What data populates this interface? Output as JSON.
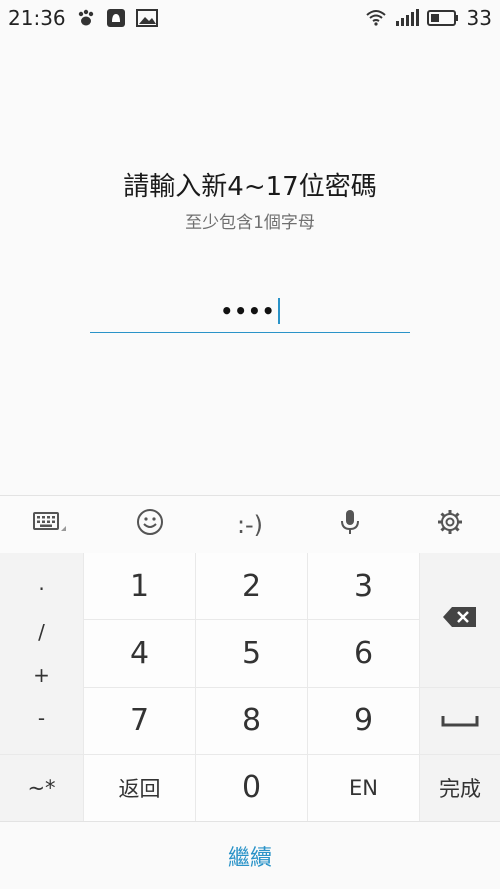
{
  "status_bar": {
    "time": "21:36",
    "battery": "33",
    "icons": [
      "paw-icon",
      "notification-icon",
      "image-icon",
      "wifi-icon",
      "signal-icon",
      "battery-icon"
    ]
  },
  "prompt": {
    "title": "請輸入新4~17位密碼",
    "subtitle": "至少包含1個字母",
    "password_masked": "••••"
  },
  "keyboard": {
    "toolbar": {
      "smiley_text": ":-)"
    },
    "symbols": [
      "·",
      "/",
      "+",
      "-"
    ],
    "digits": [
      "1",
      "2",
      "3",
      "4",
      "5",
      "6",
      "7",
      "8",
      "9",
      "0"
    ],
    "tilde_key": "~*",
    "back_key": "返回",
    "en_key": "EN",
    "done_key": "完成"
  },
  "continue_label": "繼續",
  "colors": {
    "accent": "#2a93c8",
    "background": "#fafafa",
    "key_bg": "#fdfdfd",
    "fn_bg": "#f3f3f3"
  }
}
